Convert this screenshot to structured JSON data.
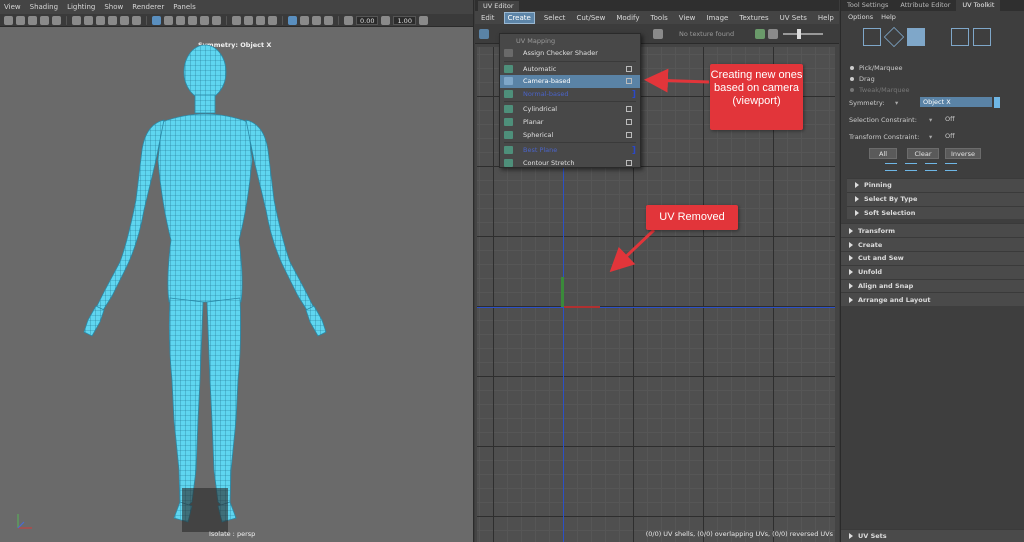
{
  "viewport": {
    "menu": [
      "View",
      "Shading",
      "Lighting",
      "Show",
      "Renderer",
      "Panels"
    ],
    "field_left": "0.00",
    "field_right": "1.00",
    "symmetry_label": "Symmetry: Object X",
    "camera_label": "Isolate : persp",
    "model_color": "#5fd6f0"
  },
  "uv_editor": {
    "title": "UV Editor",
    "menu": [
      "Edit",
      "Create",
      "Select",
      "Cut/Sew",
      "Modify",
      "Tools",
      "View",
      "Image",
      "Textures",
      "UV Sets",
      "Help"
    ],
    "active_menu": "Create",
    "texture_status": "No texture found",
    "status_bar": "(0/0) UV shells, (0/0) overlapping UVs, (0/0) reversed UVs",
    "axis_color": "#2b50c8"
  },
  "create_menu": {
    "section_title": "UV Mapping",
    "assign_checker": "Assign Checker Shader",
    "items": [
      {
        "label": "Automatic",
        "icon": "automatic-mapping-icon"
      },
      {
        "label": "Camera-based",
        "icon": "camera-mapping-icon",
        "selected": true
      },
      {
        "label": "Normal-based",
        "icon": "normal-mapping-icon",
        "dim": true
      },
      {
        "label": "Cylindrical",
        "icon": "cylindrical-mapping-icon"
      },
      {
        "label": "Planar",
        "icon": "planar-mapping-icon"
      },
      {
        "label": "Spherical",
        "icon": "spherical-mapping-icon"
      },
      {
        "label": "Best Plane",
        "icon": "best-plane-icon",
        "dim": true
      },
      {
        "label": "Contour Stretch",
        "icon": "contour-stretch-icon"
      }
    ]
  },
  "right_panel": {
    "tabs": [
      "Tool Settings",
      "Attribute Editor",
      "UV Toolkit"
    ],
    "active_tab": "UV Toolkit",
    "menu": [
      "Options",
      "Help"
    ],
    "modes": [
      "Pick/Marquee",
      "Drag",
      "Tweak/Marquee"
    ],
    "symmetry_label": "Symmetry:",
    "symmetry_value": "Object X",
    "selection_constraint_label": "Selection Constraint:",
    "selection_constraint_value": "Off",
    "transform_constraint_label": "Transform Constraint:",
    "transform_constraint_value": "Off",
    "buttons": [
      "All",
      "Clear",
      "Inverse"
    ],
    "subsections": [
      "Pinning",
      "Select By Type",
      "Soft Selection"
    ],
    "sections": [
      "Transform",
      "Create",
      "Cut and Sew",
      "Unfold",
      "Align and Snap",
      "Arrange and Layout"
    ],
    "bottom_section": "UV Sets"
  },
  "annotations": {
    "callout_camera": "Creating new ones based on camera (viewport)",
    "callout_removed": "UV Removed",
    "color": "#e2353a"
  }
}
